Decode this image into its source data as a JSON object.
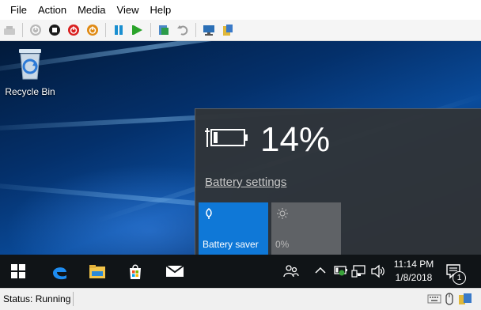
{
  "menu": {
    "items": [
      "File",
      "Action",
      "Media",
      "View",
      "Help"
    ]
  },
  "toolbar": {
    "buttons": [
      "ctrl-alt-del-icon",
      "start-icon",
      "turn-off-icon",
      "shut-down-icon",
      "save-icon",
      "pause-icon",
      "reset-icon",
      "checkpoint-icon",
      "revert-icon",
      "enhanced-session-icon",
      "share-icon"
    ]
  },
  "desktop": {
    "recycle_bin_label": "Recycle Bin"
  },
  "battery_flyout": {
    "percent": "14%",
    "settings_link": "Battery settings",
    "tile_saver_label": "Battery saver",
    "tile_brightness_label": "0%",
    "accent": "#0f78d7"
  },
  "taskbar": {
    "time": "11:14 PM",
    "date": "1/8/2018",
    "notification_count": "1"
  },
  "statusbar": {
    "status": "Status: Running"
  }
}
